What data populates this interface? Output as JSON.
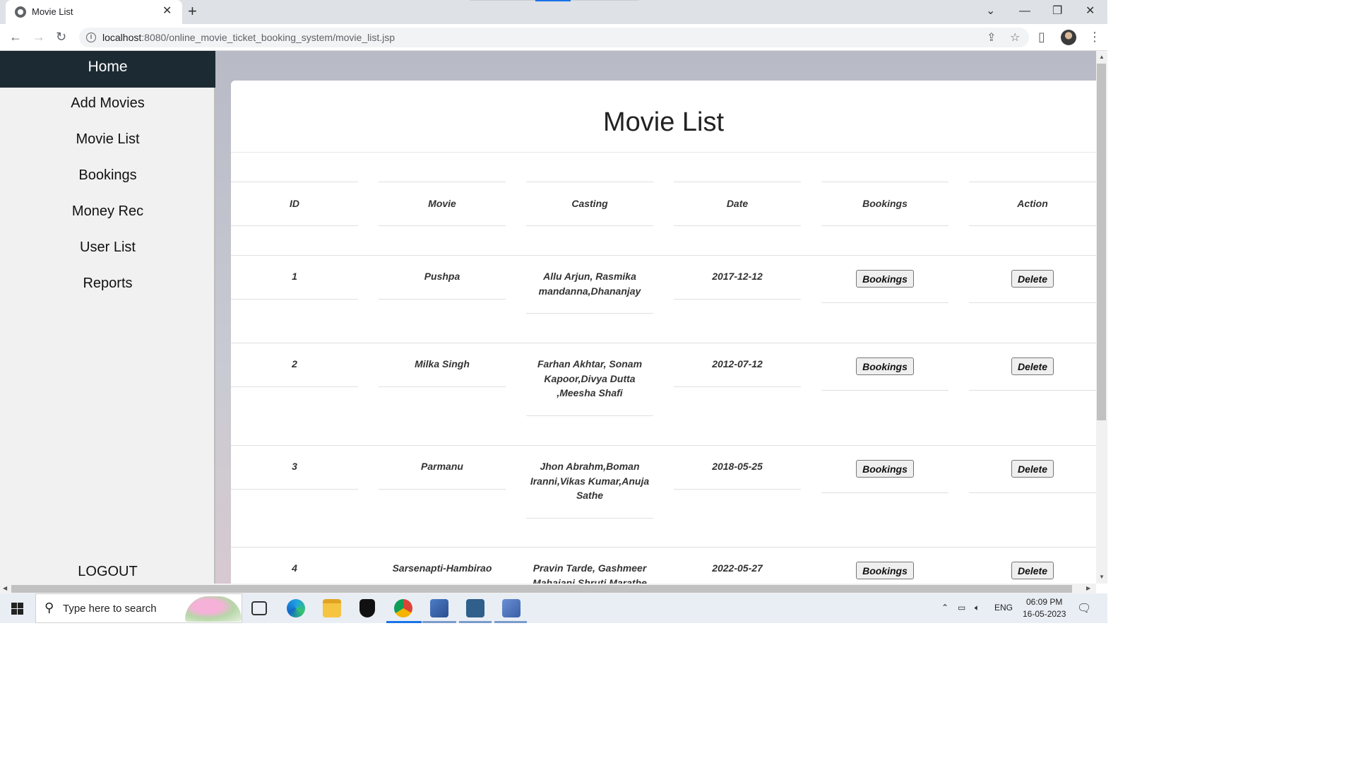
{
  "browser": {
    "tab_title": "Movie List",
    "url_host": "localhost",
    "url_rest": ":8080/online_movie_ticket_booking_system/movie_list.jsp"
  },
  "sidebar": {
    "home": "Home",
    "items": [
      {
        "label": "Add Movies"
      },
      {
        "label": "Movie List"
      },
      {
        "label": "Bookings"
      },
      {
        "label": "Money Rec"
      },
      {
        "label": "User List"
      },
      {
        "label": "Reports"
      }
    ],
    "logout": "LOGOUT"
  },
  "main": {
    "title": "Movie List",
    "columns": [
      "ID",
      "Movie",
      "Casting",
      "Date",
      "Bookings",
      "Action"
    ],
    "rows": [
      {
        "id": "1",
        "movie": "Pushpa",
        "casting": "Allu Arjun, Rasmika mandanna,Dhananjay",
        "date": "2017-12-12",
        "bookings_btn": "Bookings",
        "action_btn": "Delete"
      },
      {
        "id": "2",
        "movie": "Milka Singh",
        "casting": "Farhan Akhtar, Sonam Kapoor,Divya Dutta ,Meesha Shafi",
        "date": "2012-07-12",
        "bookings_btn": "Bookings",
        "action_btn": "Delete"
      },
      {
        "id": "3",
        "movie": "Parmanu",
        "casting": "Jhon Abrahm,Boman Iranni,Vikas Kumar,Anuja Sathe",
        "date": "2018-05-25",
        "bookings_btn": "Bookings",
        "action_btn": "Delete"
      },
      {
        "id": "4",
        "movie": "Sarsenapti-Hambirao",
        "casting": "Pravin Tarde, Gashmeer Mahajani,Shruti Marathe",
        "date": "2022-05-27",
        "bookings_btn": "Bookings",
        "action_btn": "Delete"
      }
    ]
  },
  "taskbar": {
    "search_placeholder": "Type here to search",
    "language": "ENG",
    "time": "06:09 PM",
    "date": "16-05-2023"
  }
}
